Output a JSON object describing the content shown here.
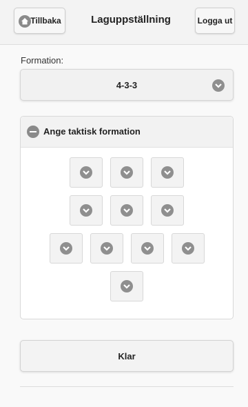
{
  "header": {
    "back_label": "Tillbaka",
    "title": "Laguppställning",
    "logout_label": "Logga ut"
  },
  "formation": {
    "label": "Formation:",
    "selected": "4-3-3"
  },
  "tactics": {
    "title": "Ange taktisk formation",
    "rows": [
      3,
      3,
      4,
      1
    ]
  },
  "actions": {
    "done_label": "Klar"
  }
}
